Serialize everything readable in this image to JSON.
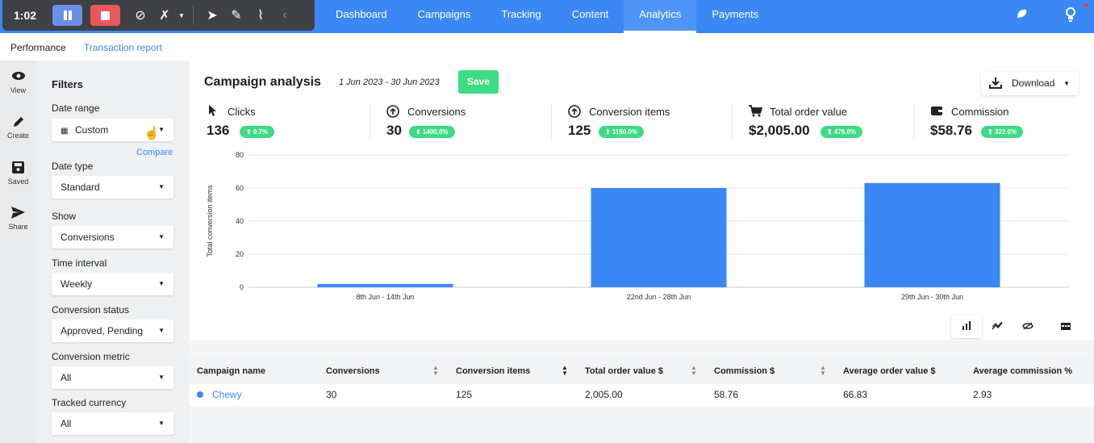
{
  "recorder": {
    "time": "1:02"
  },
  "nav": {
    "items": [
      "Dashboard",
      "Campaigns",
      "Tracking",
      "Content",
      "Analytics",
      "Payments"
    ],
    "active": "Analytics"
  },
  "subtabs": {
    "active": "Performance",
    "link": "Transaction report"
  },
  "rail": [
    {
      "label": "View",
      "icon": "eye-icon"
    },
    {
      "label": "Create",
      "icon": "pencil-icon"
    },
    {
      "label": "Saved",
      "icon": "save-icon"
    },
    {
      "label": "Share",
      "icon": "send-icon"
    }
  ],
  "filters": {
    "title": "Filters",
    "date_range": {
      "label": "Date range",
      "value": "Custom"
    },
    "compare": "Compare",
    "date_type": {
      "label": "Date type",
      "value": "Standard"
    },
    "show": {
      "label": "Show",
      "value": "Conversions"
    },
    "time_interval": {
      "label": "Time interval",
      "value": "Weekly"
    },
    "conversion_status": {
      "label": "Conversion status",
      "value": "Approved, Pending"
    },
    "conversion_metric": {
      "label": "Conversion metric",
      "value": "All"
    },
    "tracked_currency": {
      "label": "Tracked currency",
      "value": "All"
    }
  },
  "header": {
    "title": "Campaign analysis",
    "dates": "1 Jun 2023 - 30 Jun 2023",
    "save": "Save",
    "download": "Download"
  },
  "kpis": [
    {
      "label": "Clicks",
      "value": "136",
      "change": "⬆ 0.7%",
      "icon": "cursor-icon"
    },
    {
      "label": "Conversions",
      "value": "30",
      "change": "⬆ 1400.0%",
      "icon": "up-circle-icon"
    },
    {
      "label": "Conversion items",
      "value": "125",
      "change": "⬆ 1150.0%",
      "icon": "up-circle-icon"
    },
    {
      "label": "Total order value",
      "value": "$2,005.00",
      "change": "⬆ 476.0%",
      "icon": "cart-icon"
    },
    {
      "label": "Commission",
      "value": "$58.76",
      "change": "⬆ 322.0%",
      "icon": "wallet-icon"
    }
  ],
  "chart_data": {
    "type": "bar",
    "categories": [
      "8th Jun - 14th Jun",
      "22nd Jun - 28th Jun",
      "29th Jun - 30th Jun"
    ],
    "values": [
      2,
      60,
      63
    ],
    "title": "",
    "xlabel": "",
    "ylabel": "Total conversion items",
    "ylim": [
      0,
      80
    ],
    "yticks": [
      0,
      20,
      40,
      60,
      80
    ],
    "grid": true,
    "color": "#3b88f5"
  },
  "table": {
    "columns": [
      "Campaign name",
      "Conversions",
      "Conversion items",
      "Total order value $",
      "Commission $",
      "Average order value $",
      "Average commission %"
    ],
    "rows": [
      [
        "Chewy",
        "30",
        "125",
        "2,005.00",
        "58.76",
        "66.83",
        "2.93"
      ]
    ]
  },
  "colors": {
    "accent": "#3b88f5",
    "success": "#3ddc84"
  }
}
